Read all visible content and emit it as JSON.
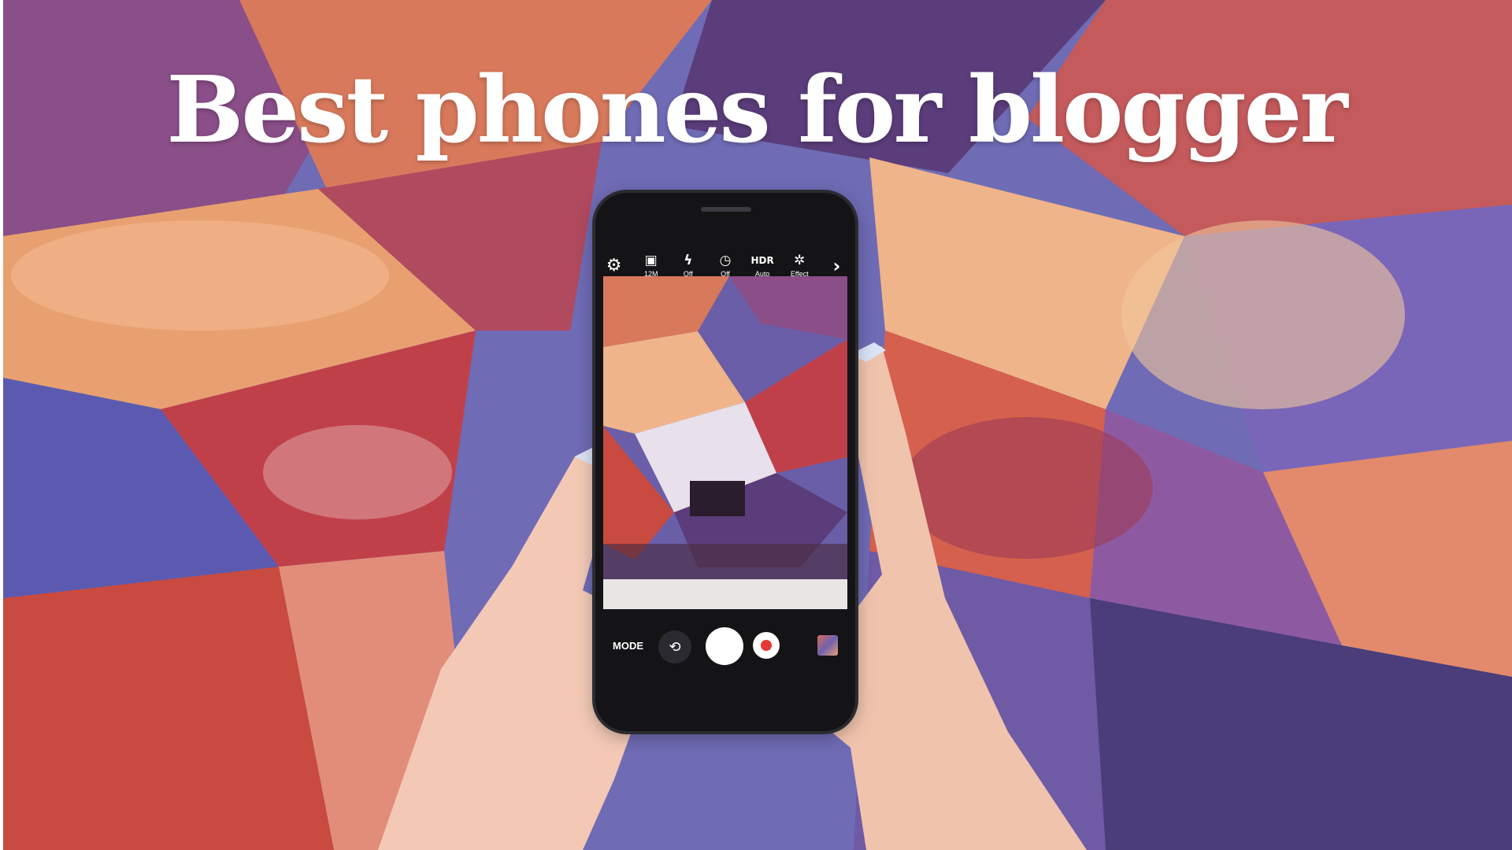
{
  "title": "Best phones for blogger",
  "camera": {
    "toolbar": [
      {
        "icon": "gear-icon",
        "label": ""
      },
      {
        "icon": "resolution-icon",
        "label": "12M"
      },
      {
        "icon": "flash-icon",
        "label": "Off"
      },
      {
        "icon": "timer-icon",
        "label": "Off"
      },
      {
        "icon": "hdr-icon",
        "label": "Auto",
        "icon_text": "HDR"
      },
      {
        "icon": "effect-icon",
        "label": "Effect"
      },
      {
        "icon": "chevron-right-icon",
        "label": ""
      }
    ],
    "mode_label": "MODE"
  },
  "colors": {
    "mural_purple": "#6f6bb5",
    "mural_red": "#c75b58",
    "mural_peach": "#e8a070",
    "phone_body": "#141416"
  }
}
